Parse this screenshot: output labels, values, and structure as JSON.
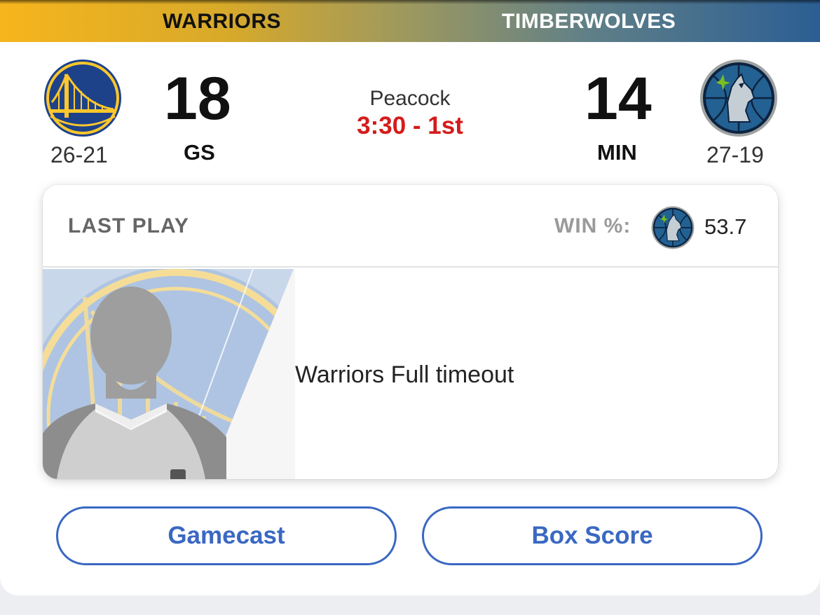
{
  "header": {
    "home_team": "WARRIORS",
    "away_team": "TIMBERWOLVES",
    "home_color": "#f6b51d",
    "away_color": "#2b5e93"
  },
  "game": {
    "home": {
      "abbr": "GS",
      "score": "18",
      "record": "26-21",
      "logo_icon": "warriors-logo-icon",
      "primary_color": "#1d428a",
      "secondary_color": "#ffc72c"
    },
    "away": {
      "abbr": "MIN",
      "score": "14",
      "record": "27-19",
      "logo_icon": "timberwolves-logo-icon",
      "primary_color": "#0c2340",
      "secondary_color": "#236192"
    },
    "network": "Peacock",
    "clock": "3:30 - 1st",
    "clock_color": "#d51b1b"
  },
  "last_play": {
    "title": "LAST PLAY",
    "win_label": "WIN %:",
    "win_team_icon": "timberwolves-logo-icon",
    "win_value": "53.7",
    "image_icon": "referee-silhouette-icon",
    "description": "Warriors Full timeout"
  },
  "buttons": {
    "gamecast": "Gamecast",
    "box_score": "Box Score",
    "accent_color": "#3a68c2"
  }
}
